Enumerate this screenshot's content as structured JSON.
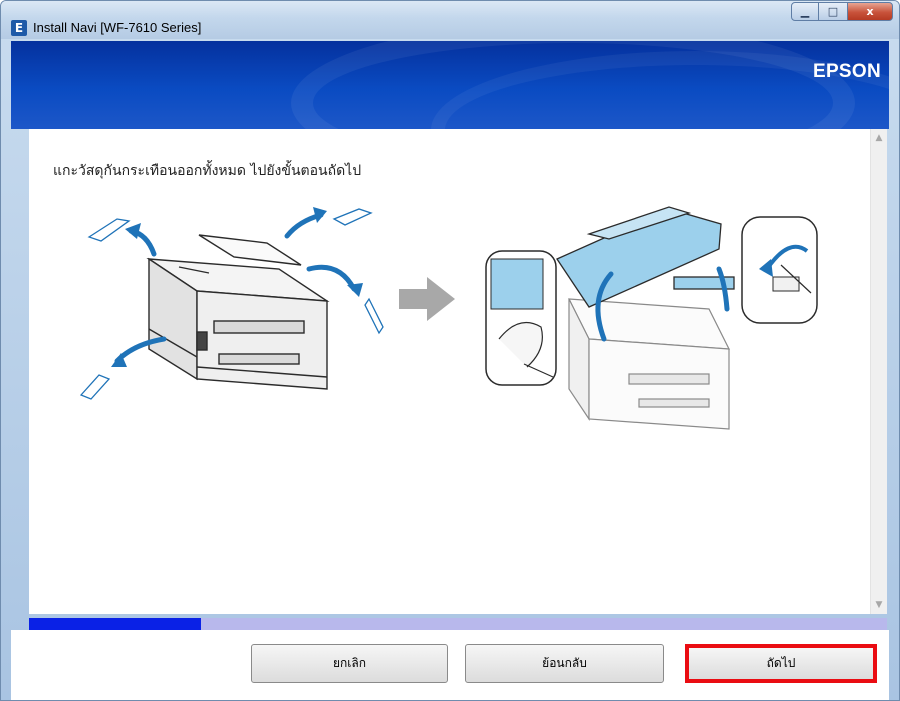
{
  "window": {
    "app_icon": "epson-e-icon",
    "title": "Install Navi [WF-7610 Series]",
    "minimize_glyph": "▁",
    "maximize_glyph": "□",
    "close_glyph": "x"
  },
  "banner": {
    "brand": "EPSON"
  },
  "content": {
    "instruction": "แกะวัสดุกันกระเทือนออกทั้งหมด  ไปยังขั้นตอนถัดไป"
  },
  "scrollbar": {
    "up_glyph": "▲",
    "down_glyph": "▼"
  },
  "progress": {
    "value": 0.2
  },
  "footer": {
    "cancel_label": "ยกเลิก",
    "back_label": "ย้อนกลับ",
    "next_label": "ถัดไป"
  },
  "colors": {
    "banner": "#0a4bc2",
    "progress_fill": "#0a21e6",
    "progress_track": "#b8b8ec",
    "highlight": "#ea0c12",
    "arrow_blue": "#1f73b8"
  }
}
